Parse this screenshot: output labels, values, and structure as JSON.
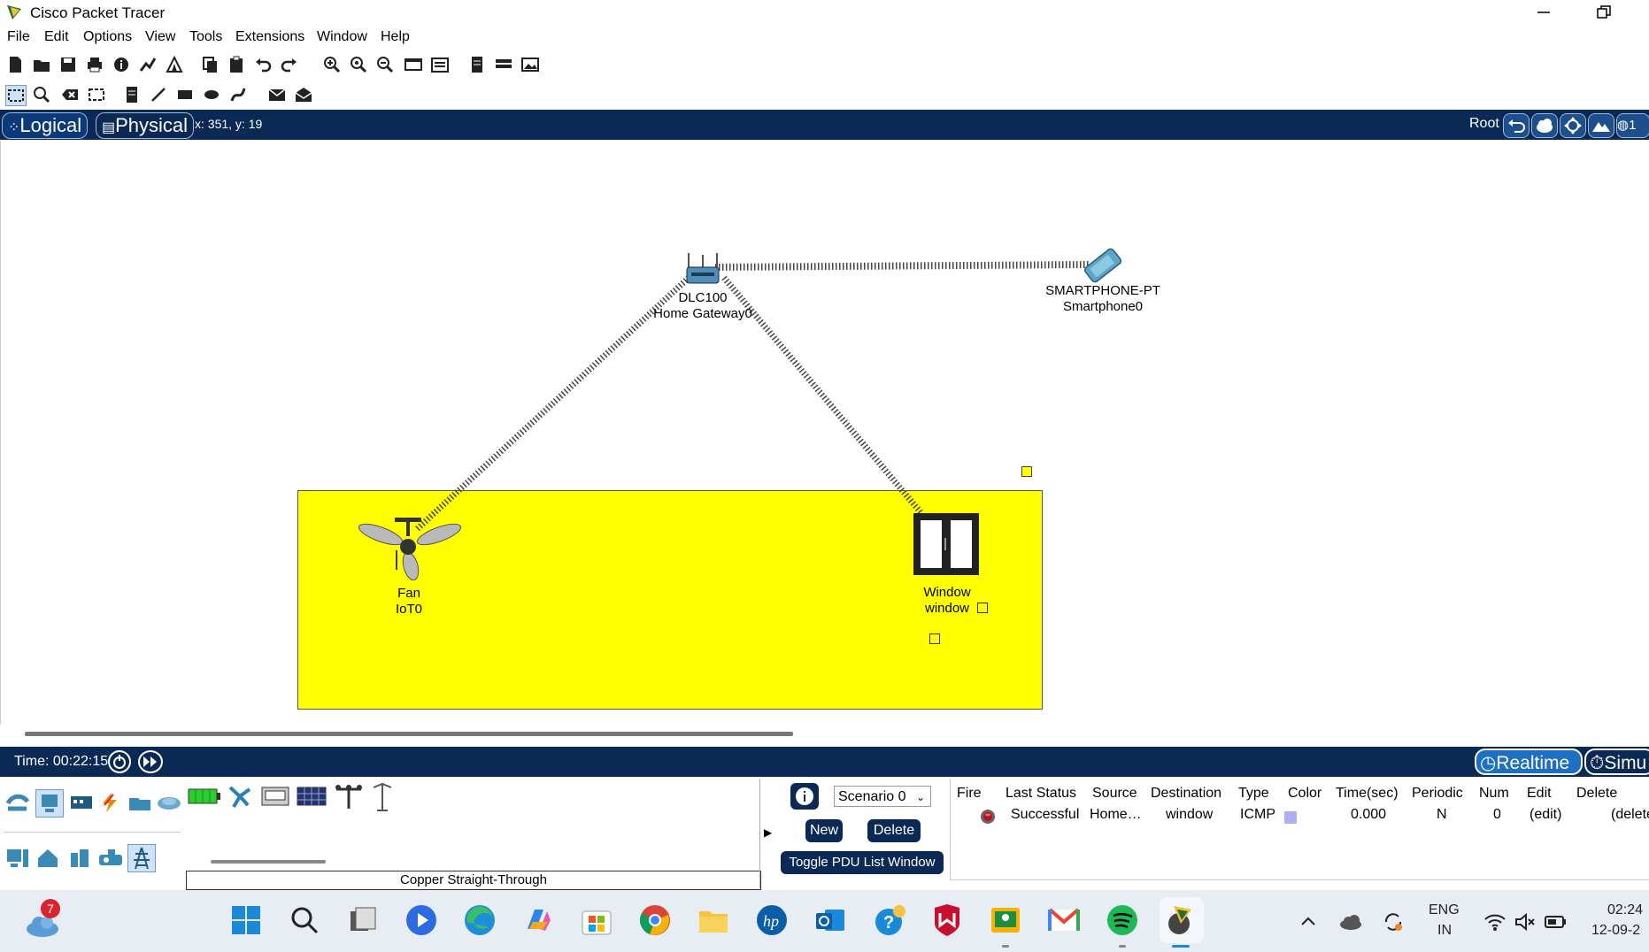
{
  "window": {
    "title": "Cisco Packet Tracer"
  },
  "menu": [
    "File",
    "Edit",
    "Options",
    "View",
    "Tools",
    "Extensions",
    "Window",
    "Help"
  ],
  "modebar": {
    "logical": "Logical",
    "physical": "Physical",
    "coords": "x: 351, y: 19",
    "root": "Root",
    "overflow": "1"
  },
  "devices": {
    "gateway": {
      "model": "DLC100",
      "name": "Home Gateway0"
    },
    "smartphone": {
      "model": "SMARTPHONE-PT",
      "name": "Smartphone0"
    },
    "fan": {
      "model": "Fan",
      "name": "IoT0"
    },
    "window": {
      "model": "Window",
      "name": "window"
    }
  },
  "statusbar": {
    "time": "Time: 00:22:15",
    "realtime": "Realtime",
    "simulation": "Simu"
  },
  "device_panel": {
    "connection_label": "Copper Straight-Through"
  },
  "scenario": {
    "selected": "Scenario 0",
    "new": "New",
    "delete": "Delete",
    "toggle": "Toggle PDU List Window"
  },
  "pdu_table": {
    "headers": [
      "Fire",
      "Last Status",
      "Source",
      "Destination",
      "Type",
      "Color",
      "Time(sec)",
      "Periodic",
      "Num",
      "Edit",
      "Delete"
    ],
    "rows": [
      {
        "last_status": "Successful",
        "source": "Home…",
        "destination": "window",
        "type": "ICMP",
        "color": "#aab0f0",
        "time": "0.000",
        "periodic": "N",
        "num": "0",
        "edit": "(edit)",
        "delete": "(delete"
      }
    ]
  },
  "taskbar": {
    "weather_badge": "7",
    "lang_top": "ENG",
    "lang_bottom": "IN",
    "clock_time": "02:24",
    "clock_date": "12-09-2"
  },
  "colors": {
    "accent_navy": "#0a2a55",
    "cluster_yellow": "#ffff00"
  }
}
